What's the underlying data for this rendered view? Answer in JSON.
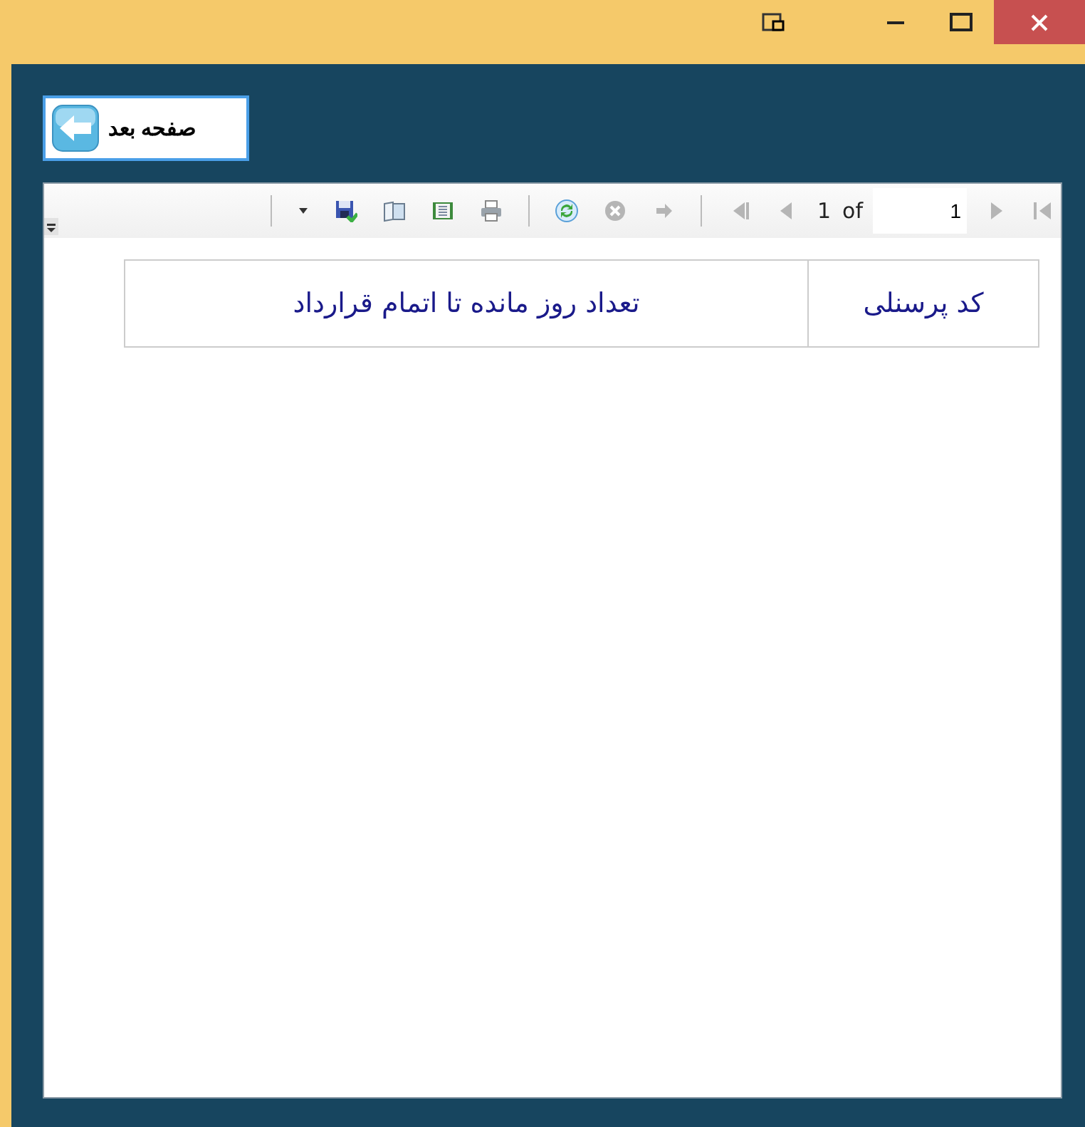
{
  "window": {
    "controls": [
      {
        "kind": "snap"
      },
      {
        "kind": "minimize"
      },
      {
        "kind": "maximize"
      },
      {
        "kind": "close"
      }
    ]
  },
  "next_page_button": {
    "label": "صفحه بعد"
  },
  "report_viewer": {
    "toolbar": [
      {
        "kind": "last",
        "disabled": true
      },
      {
        "kind": "next",
        "disabled": true
      },
      {
        "kind": "page-field",
        "value": "1"
      },
      {
        "kind": "text",
        "text": "of"
      },
      {
        "kind": "text",
        "text": "1"
      },
      {
        "kind": "previous",
        "disabled": true
      },
      {
        "kind": "first",
        "disabled": true
      },
      {
        "kind": "separator"
      },
      {
        "kind": "back",
        "disabled": true
      },
      {
        "kind": "stop",
        "disabled": true
      },
      {
        "kind": "refresh"
      },
      {
        "kind": "separator"
      },
      {
        "kind": "print"
      },
      {
        "kind": "page-setup"
      },
      {
        "kind": "layout"
      },
      {
        "kind": "export"
      },
      {
        "kind": "dropdown"
      },
      {
        "kind": "separator"
      }
    ],
    "table": {
      "columns": [
        "کد پرسنلی",
        "تعداد روز مانده تا اتمام قرارداد"
      ]
    }
  }
}
